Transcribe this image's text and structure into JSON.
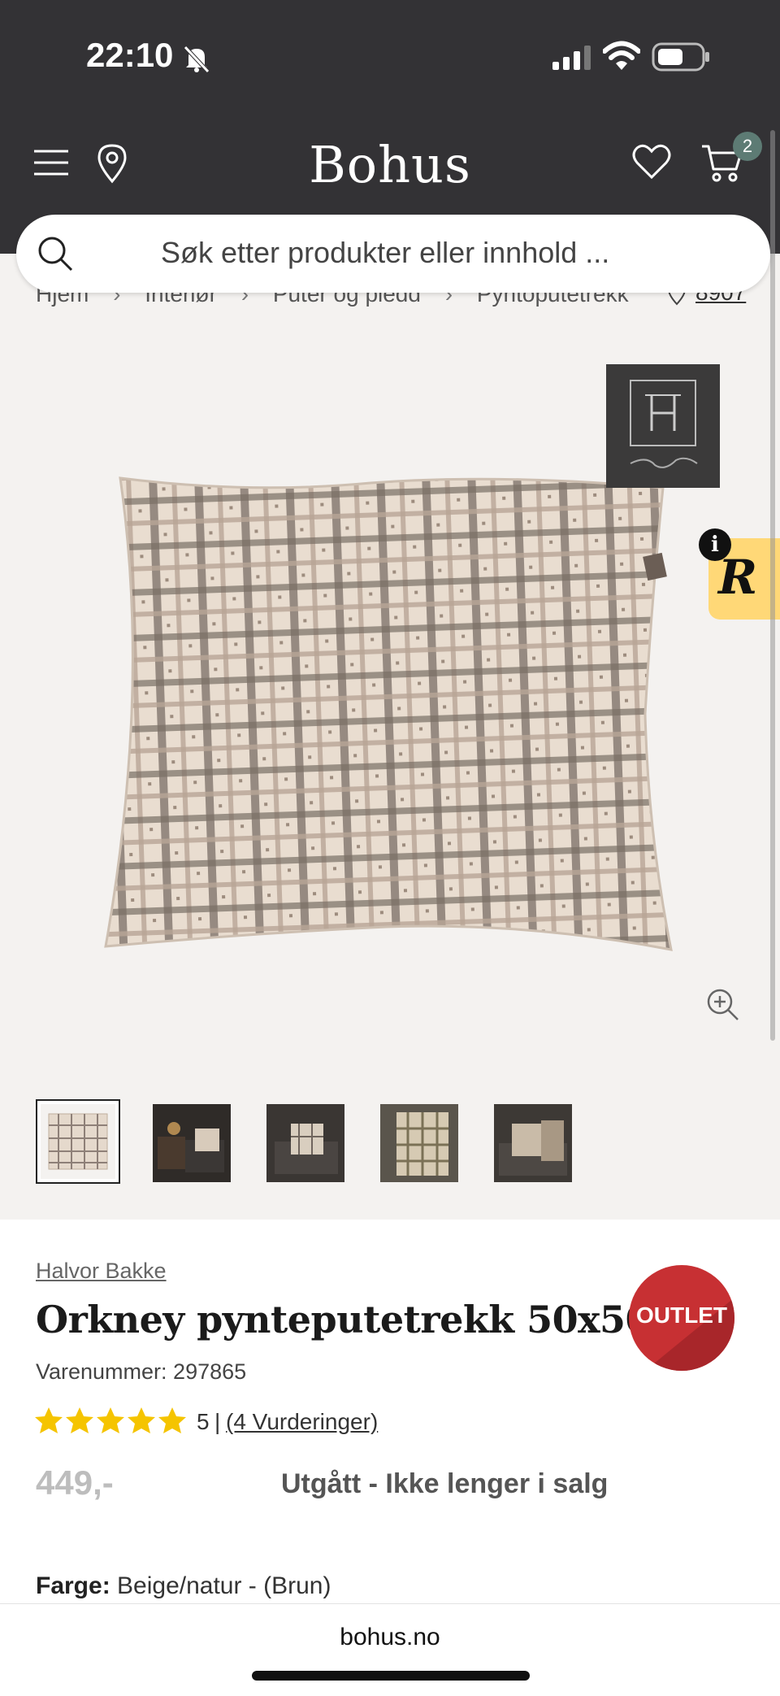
{
  "status_bar": {
    "time": "22:10"
  },
  "header": {
    "logo": "Bohus",
    "cart_count": "2"
  },
  "search": {
    "placeholder": "Søk etter produkter eller innhold ..."
  },
  "breadcrumbs": [
    "Hjem",
    "Interiør",
    "Puter og pledd",
    "Pyntoputetrekk"
  ],
  "store": {
    "label": "8907"
  },
  "product": {
    "brand": "Halvor Bakke",
    "title": "Orkney pynteputetrekk 50x50",
    "sku": "Varenummer: 297865",
    "rating_value": 5,
    "rating_score": "5",
    "rating_separator": "|",
    "rating_link": "(4 Vurderinger)",
    "price": "449,-",
    "availability": "Utgått - Ikke lenger i salg",
    "color_label": "Farge:",
    "color_value": "Beige/natur - (Brun)",
    "badge": "OUTLET"
  },
  "rbadge": {
    "letter": "R",
    "info": "i"
  },
  "thumbnails": {
    "count": 5,
    "selected_index": 0
  },
  "browser": {
    "url": "bohus.no"
  },
  "colors": {
    "header_bg": "#333235",
    "gallery_bg": "#f4f2f0",
    "outlet_red": "#c73033",
    "star_yellow": "#f5c400",
    "cart_badge": "#5d7b74"
  }
}
